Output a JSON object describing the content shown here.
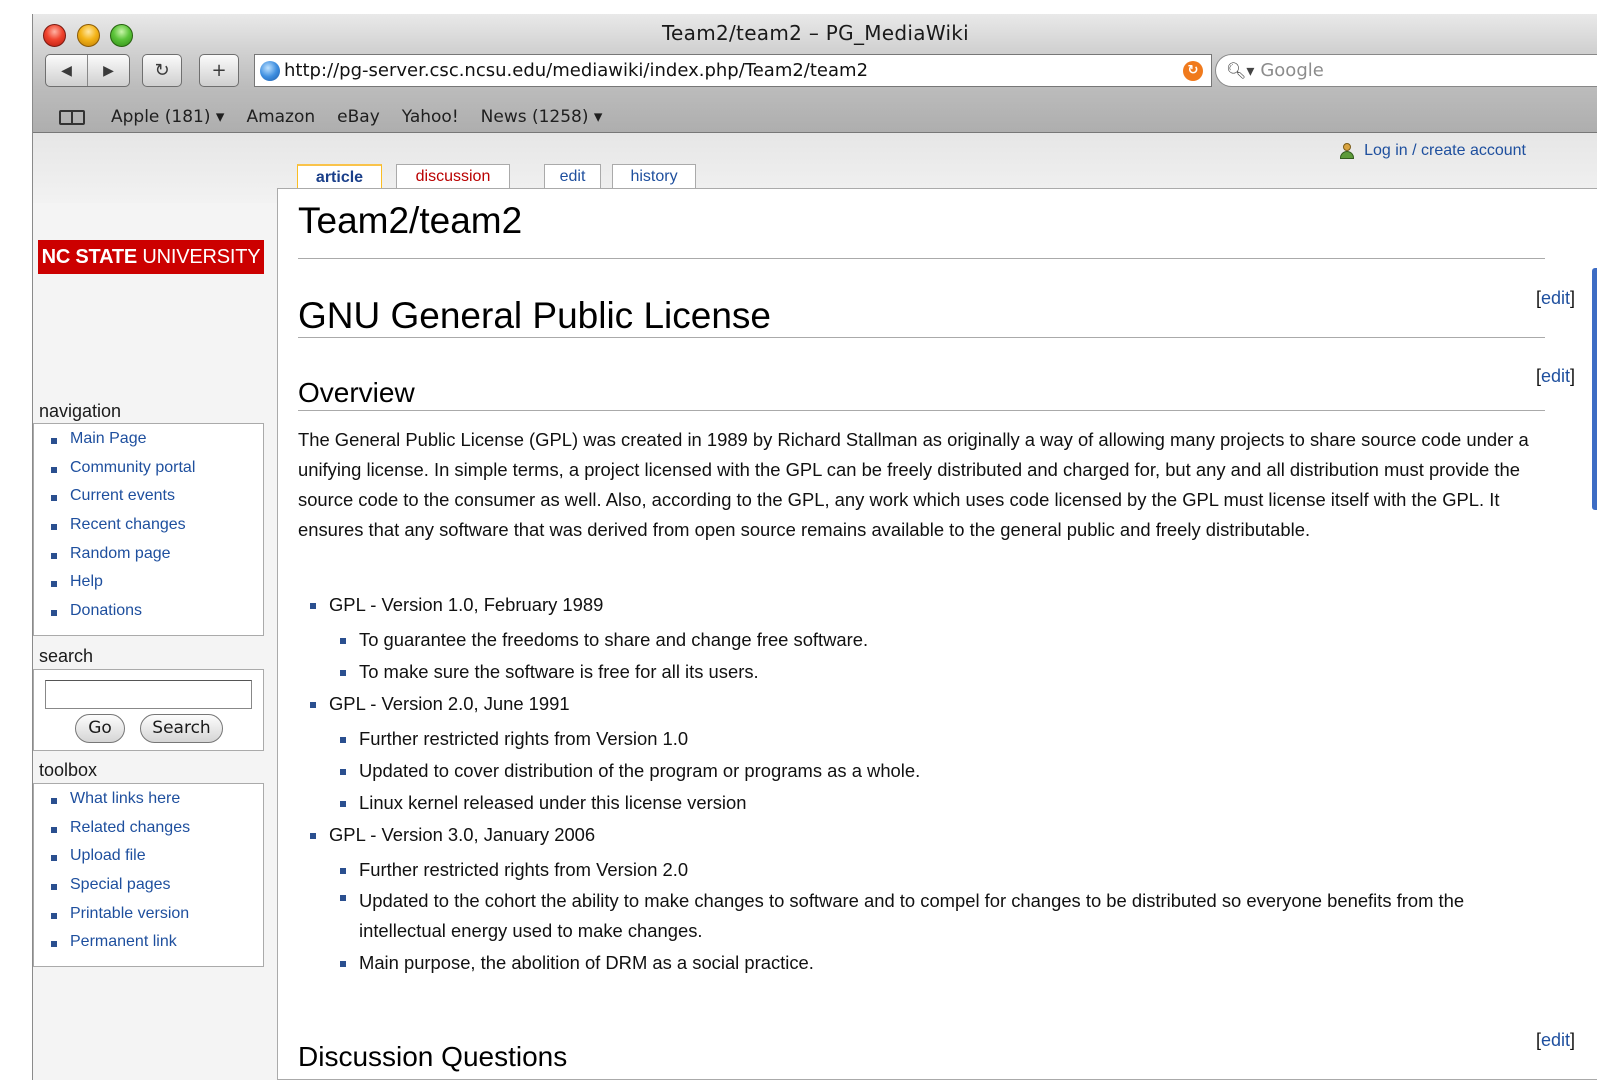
{
  "window": {
    "title": "Team2/team2 – PG_MediaWiki",
    "url": "http://pg-server.csc.ncsu.edu/mediawiki/index.php/Team2/team2",
    "search_placeholder": "Google",
    "nav_back": "◀",
    "nav_forward": "▶",
    "reload": "↻",
    "add": "+",
    "rss": "↻"
  },
  "bookmarks": [
    "Apple (181) ▾",
    "Amazon",
    "eBay",
    "Yahoo!",
    "News (1258) ▾"
  ],
  "wiki": {
    "login": "Log in / create account",
    "tabs": {
      "article": "article",
      "discussion": "discussion",
      "edit": "edit",
      "history": "history"
    },
    "logo_bold": "NC STATE",
    "logo_rest": " UNIVERSITY",
    "navigation": {
      "title": "navigation",
      "items": [
        "Main Page",
        "Community portal",
        "Current events",
        "Recent changes",
        "Random page",
        "Help",
        "Donations"
      ]
    },
    "search": {
      "title": "search",
      "go": "Go",
      "search": "Search"
    },
    "toolbox": {
      "title": "toolbox",
      "items": [
        "What links here",
        "Related changes",
        "Upload file",
        "Special pages",
        "Printable version",
        "Permanent link"
      ]
    },
    "edit_open": "[",
    "edit_label": "edit",
    "edit_close": "]",
    "page_title": "Team2/team2",
    "section_gpl": "GNU General Public License",
    "section_overview": "Overview",
    "overview_text": "The General Public License (GPL) was created in 1989 by Richard Stallman as originally a way of allowing many projects to share source code under a unifying license. In simple terms, a project licensed with the GPL can be freely distributed and charged for, but any and all distribution must provide the source code to the consumer as well. Also, according to the GPL, any work which uses code licensed by the GPL must license itself with the GPL. It ensures that any software that was derived from open source remains available to the general public and freely distributable.",
    "versions": [
      {
        "label": "GPL - Version 1.0, February 1989",
        "items": [
          "To guarantee the freedoms to share and change free software.",
          "To make sure the software is free for all its users."
        ]
      },
      {
        "label": "GPL - Version 2.0, June 1991",
        "items": [
          "Further restricted rights from Version 1.0",
          "Updated to cover distribution of the program or programs as a whole.",
          "Linux kernel released under this license version"
        ]
      },
      {
        "label": "GPL - Version 3.0, January 2006",
        "items": [
          "Further restricted rights from Version 2.0",
          "Updated to the cohort the ability to make changes to software and to compel for changes to be distributed so everyone benefits from the intellectual energy used to make changes.",
          "Main purpose, the abolition of DRM as a social practice."
        ]
      }
    ],
    "section_discussion": "Discussion Questions"
  },
  "colors": {
    "link": "#1e4f9e",
    "redlink": "#ba0000",
    "logo": "#cc0000",
    "tab_selected": "#fabd23"
  }
}
